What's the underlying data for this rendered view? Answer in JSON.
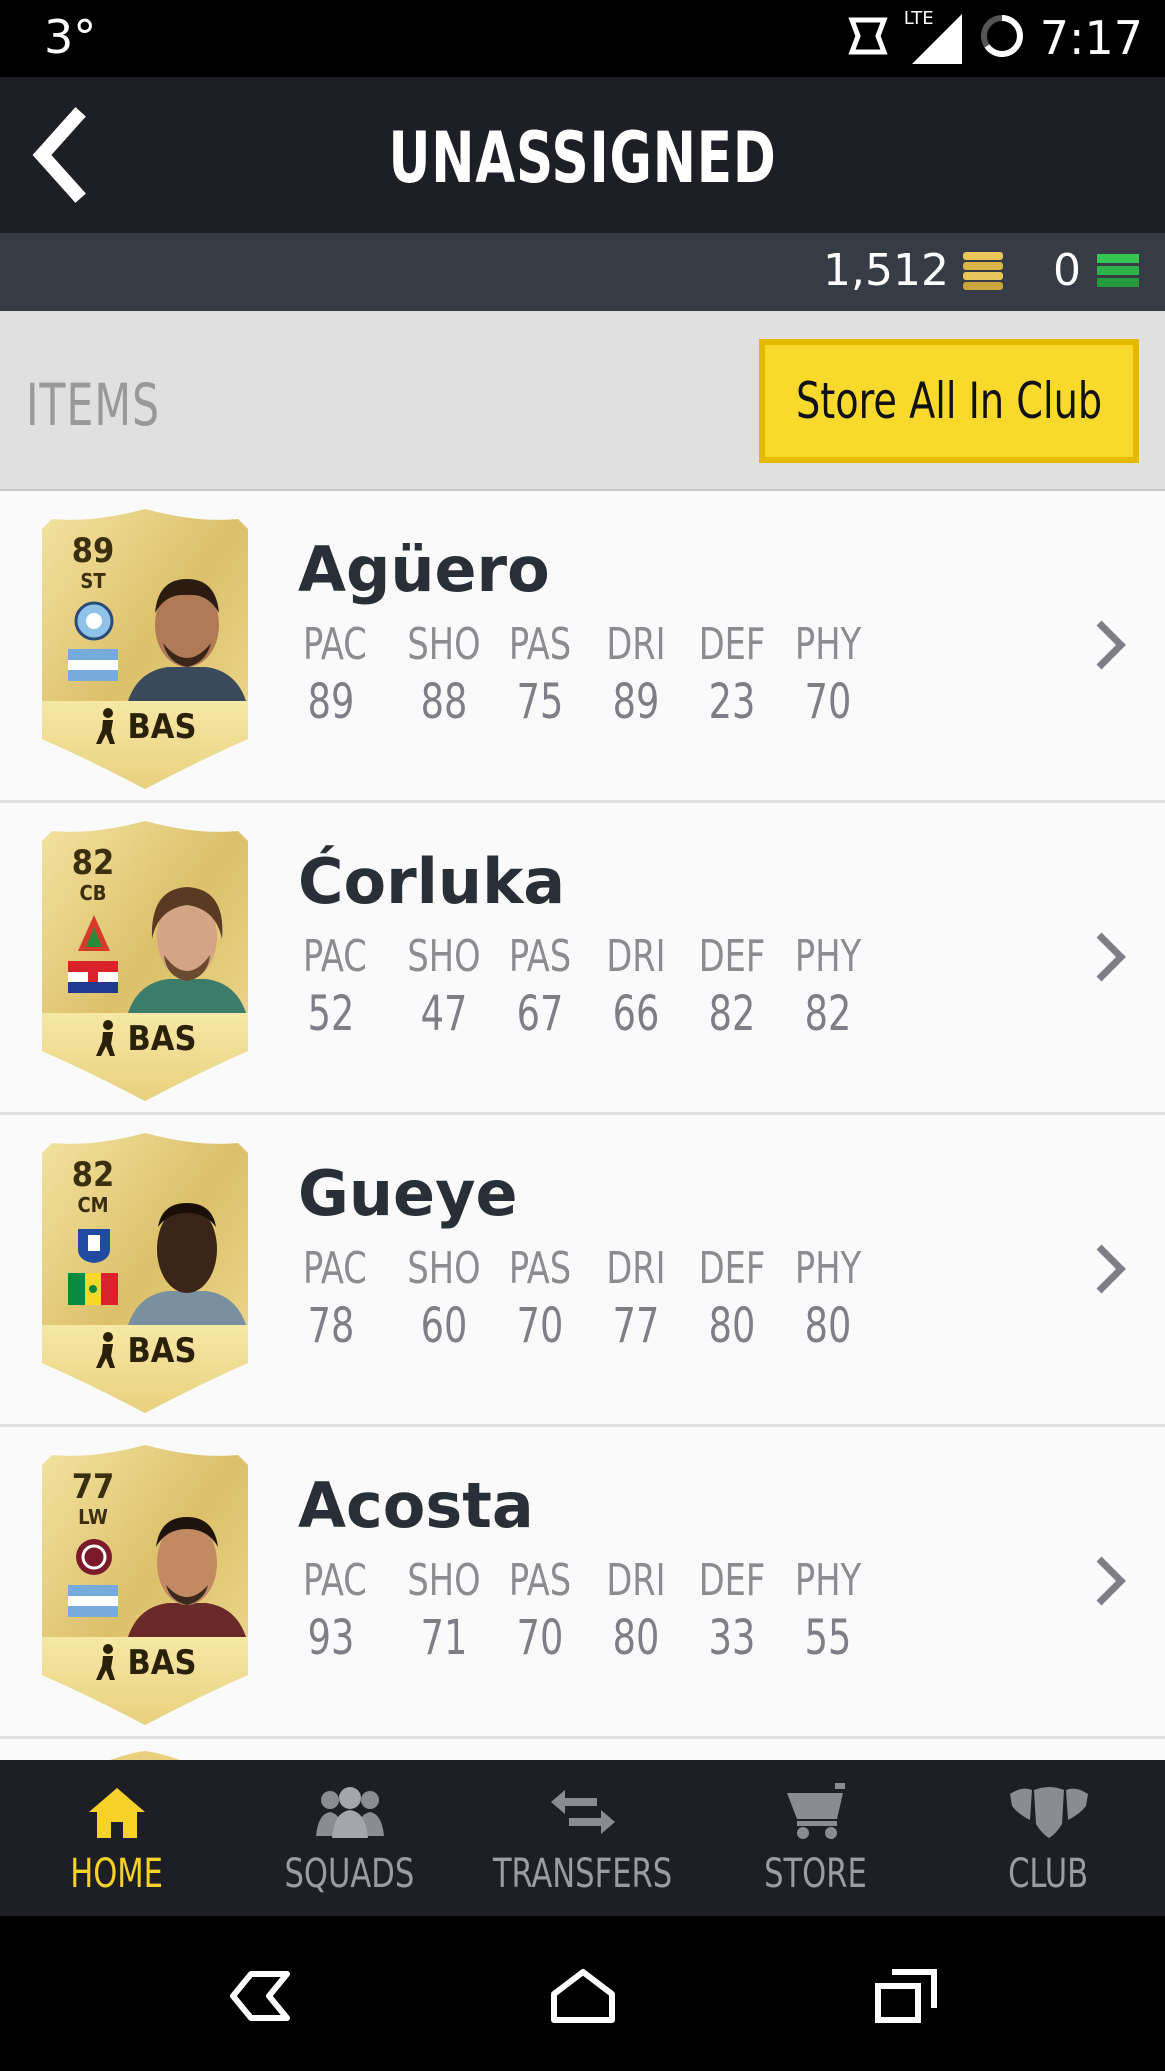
{
  "status_bar": {
    "temperature": "3°",
    "network": "LTE",
    "time": "7:17"
  },
  "header": {
    "title": "UNASSIGNED"
  },
  "currency": {
    "coins": "1,512",
    "points": "0",
    "coin_color": "#d9b54a",
    "points_color": "#2db34a"
  },
  "items_section": {
    "label": "ITEMS",
    "store_button_label": "Store All In Club"
  },
  "stat_labels": [
    "PAC",
    "SHO",
    "PAS",
    "DRI",
    "DEF",
    "PHY"
  ],
  "players": [
    {
      "name": "Agüero",
      "rating": "89",
      "position": "ST",
      "tag": "BAS",
      "club_icon": "manchester-city-badge",
      "nation_flag": "argentina-flag",
      "stats": [
        "89",
        "88",
        "75",
        "89",
        "23",
        "70"
      ]
    },
    {
      "name": "Ćorluka",
      "rating": "82",
      "position": "CB",
      "tag": "BAS",
      "club_icon": "lokomotiv-moscow-badge",
      "nation_flag": "croatia-flag",
      "stats": [
        "52",
        "47",
        "67",
        "66",
        "82",
        "82"
      ]
    },
    {
      "name": "Gueye",
      "rating": "82",
      "position": "CM",
      "tag": "BAS",
      "club_icon": "everton-badge",
      "nation_flag": "senegal-flag",
      "stats": [
        "78",
        "60",
        "70",
        "77",
        "80",
        "80"
      ]
    },
    {
      "name": "Acosta",
      "rating": "77",
      "position": "LW",
      "tag": "BAS",
      "club_icon": "lanus-badge",
      "nation_flag": "argentina-flag",
      "stats": [
        "93",
        "71",
        "70",
        "80",
        "33",
        "55"
      ]
    }
  ],
  "bottom_nav": [
    {
      "label": "HOME",
      "icon": "home-icon",
      "active": true
    },
    {
      "label": "SQUADS",
      "icon": "squads-icon",
      "active": false
    },
    {
      "label": "TRANSFERS",
      "icon": "transfers-icon",
      "active": false
    },
    {
      "label": "STORE",
      "icon": "cart-icon",
      "active": false
    },
    {
      "label": "CLUB",
      "icon": "club-icon",
      "active": false
    }
  ],
  "colors": {
    "accent": "#f9d92c",
    "header_bg": "#1d1f25",
    "currency_bg": "#363b46"
  }
}
